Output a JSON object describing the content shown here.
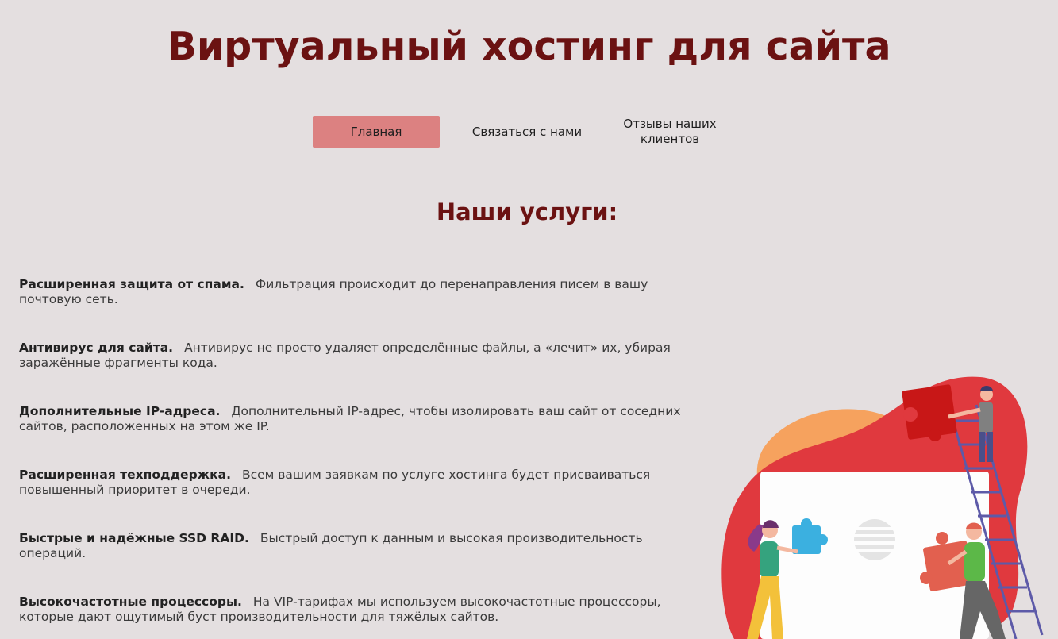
{
  "header": {
    "title": "Виртуальный хостинг для сайта"
  },
  "nav": {
    "items": [
      {
        "label": "Главная",
        "active": true
      },
      {
        "label": "Связаться с нами",
        "active": false
      },
      {
        "label": "Отзывы наших клиентов",
        "active": false
      }
    ]
  },
  "main": {
    "section_title": "Наши услуги:",
    "services": [
      {
        "name": "Расширенная защита от спама.",
        "description": "Фильтрация происходит до перенаправления писем в вашу почтовую сеть."
      },
      {
        "name": "Антивирус для сайта.",
        "description": "Антивирус не просто удаляет определённые файлы, а «лечит» их, убирая заражённые фрагменты кода."
      },
      {
        "name": "Дополнительные IP-адреса.",
        "description": "Дополнительный IP-адрес, чтобы изолировать ваш сайт от соседних сайтов, расположенных на этом же IP."
      },
      {
        "name": "Расширенная техподдержка.",
        "description": "Всем вашим заявкам по услуге хостинга будет присваиваться повышенный приоритет в очереди."
      },
      {
        "name": "Быстрые и надёжные SSD RAID.",
        "description": "Быстрый доступ к данным и высокая производительность операций."
      },
      {
        "name": "Высокочастотные процессоры.",
        "description": "На VIP-тарифах мы используем высокочастотные процессоры, которые дают ощутимый буст производительности для тяжёлых сайтов."
      }
    ]
  },
  "illustration": {
    "icon": "teamwork-puzzle-illustration",
    "colors": {
      "blob_red": "#e0393e",
      "blob_orange": "#f6a25e",
      "puzzle_dark_red": "#c81717",
      "puzzle_blue": "#3bb0e0",
      "puzzle_coral": "#e2604f",
      "ladder": "#5d5aa8"
    }
  },
  "colors": {
    "background": "#e4dfe0",
    "title": "#6b1212",
    "nav_active": "#dc8181"
  }
}
